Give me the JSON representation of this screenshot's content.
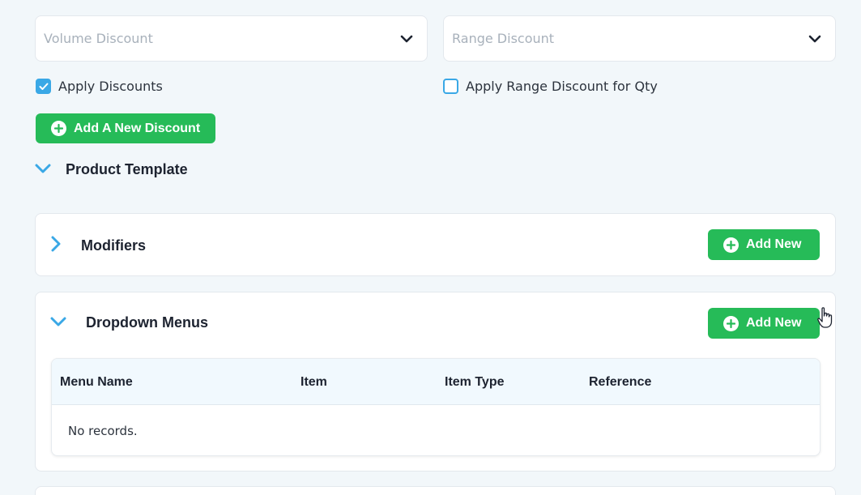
{
  "discount_selects": {
    "volume_placeholder": "Volume Discount",
    "range_placeholder": "Range Discount"
  },
  "checkboxes": {
    "apply_discounts": {
      "label": "Apply Discounts",
      "checked": true
    },
    "apply_range_qty": {
      "label": "Apply Range Discount for Qty",
      "checked": false
    }
  },
  "buttons": {
    "add_discount": "Add A New Discount",
    "add_new": "Add New"
  },
  "sections": {
    "product_template": "Product Template",
    "modifiers": "Modifiers",
    "dropdown_menus": "Dropdown Menus"
  },
  "dropdown_table": {
    "columns": [
      "Menu Name",
      "Item",
      "Item Type",
      "Reference"
    ],
    "empty_text": "No records."
  },
  "colors": {
    "accent_blue": "#3aa8e6",
    "green": "#26bb58",
    "background": "#f2f7fa"
  },
  "icons": {
    "select_arrow": "chevron-down-icon",
    "expanded": "chevron-down-icon",
    "collapsed": "chevron-right-icon",
    "add": "plus-circle-icon",
    "check": "checkmark-icon",
    "pointer": "hand-pointer-icon"
  }
}
